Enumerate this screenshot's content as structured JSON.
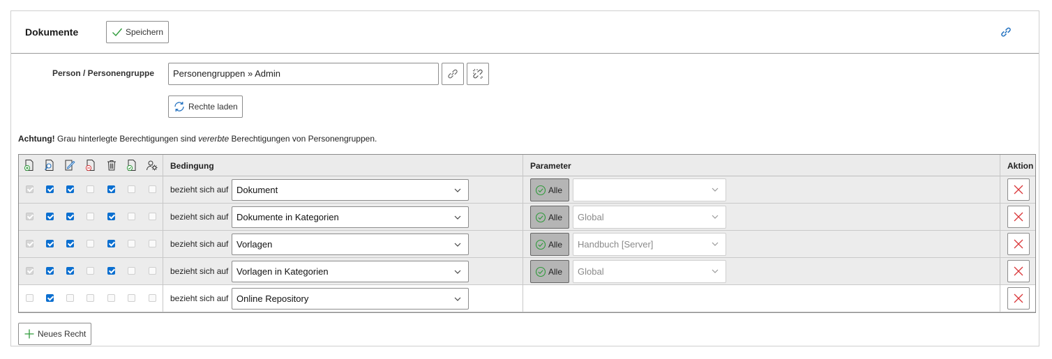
{
  "header": {
    "title": "Dokumente",
    "save_label": "Speichern"
  },
  "person": {
    "label": "Person / Personengruppe",
    "value": "Personengruppen » Admin",
    "load_rights_label": "Rechte laden"
  },
  "notice": {
    "bold": "Achtung!",
    "part1": "Grau hinterlegte Berechtigungen sind",
    "italic": "vererbte",
    "part2": "Berechtigungen von Personengruppen."
  },
  "table": {
    "columns": {
      "condition": "Bedingung",
      "parameter": "Parameter",
      "action": "Aktion"
    },
    "permission_icons": [
      "create-icon",
      "view-icon",
      "edit-icon",
      "remove-icon",
      "delete-icon",
      "release-icon",
      "admin-icon"
    ],
    "rows": [
      {
        "inherited": true,
        "checks": [
          "dis",
          "on",
          "on",
          "off",
          "on",
          "off",
          "off"
        ],
        "condition_text": "bezieht sich auf",
        "condition_value": "Dokument",
        "has_param": true,
        "alle_label": "Alle",
        "param_value": ""
      },
      {
        "inherited": true,
        "checks": [
          "dis",
          "on",
          "on",
          "off",
          "on",
          "off",
          "off"
        ],
        "condition_text": "bezieht sich auf",
        "condition_value": "Dokumente in Kategorien",
        "has_param": true,
        "alle_label": "Alle",
        "param_value": "Global"
      },
      {
        "inherited": true,
        "checks": [
          "dis",
          "on",
          "on",
          "off",
          "on",
          "off",
          "off"
        ],
        "condition_text": "bezieht sich auf",
        "condition_value": "Vorlagen",
        "has_param": true,
        "alle_label": "Alle",
        "param_value": "Handbuch [Server]"
      },
      {
        "inherited": true,
        "checks": [
          "dis",
          "on",
          "on",
          "off",
          "on",
          "off",
          "off"
        ],
        "condition_text": "bezieht sich auf",
        "condition_value": "Vorlagen in Kategorien",
        "has_param": true,
        "alle_label": "Alle",
        "param_value": "Global"
      },
      {
        "inherited": false,
        "checks": [
          "off",
          "on",
          "off",
          "off",
          "off",
          "off",
          "off"
        ],
        "condition_text": "bezieht sich auf",
        "condition_value": "Online Repository",
        "has_param": false
      }
    ]
  },
  "new_right_label": "Neues Recht",
  "colors": {
    "accent": "#0b6fd0",
    "delete": "#d9373a",
    "success": "#2e9a3a",
    "inherited_bg": "#ececec"
  }
}
